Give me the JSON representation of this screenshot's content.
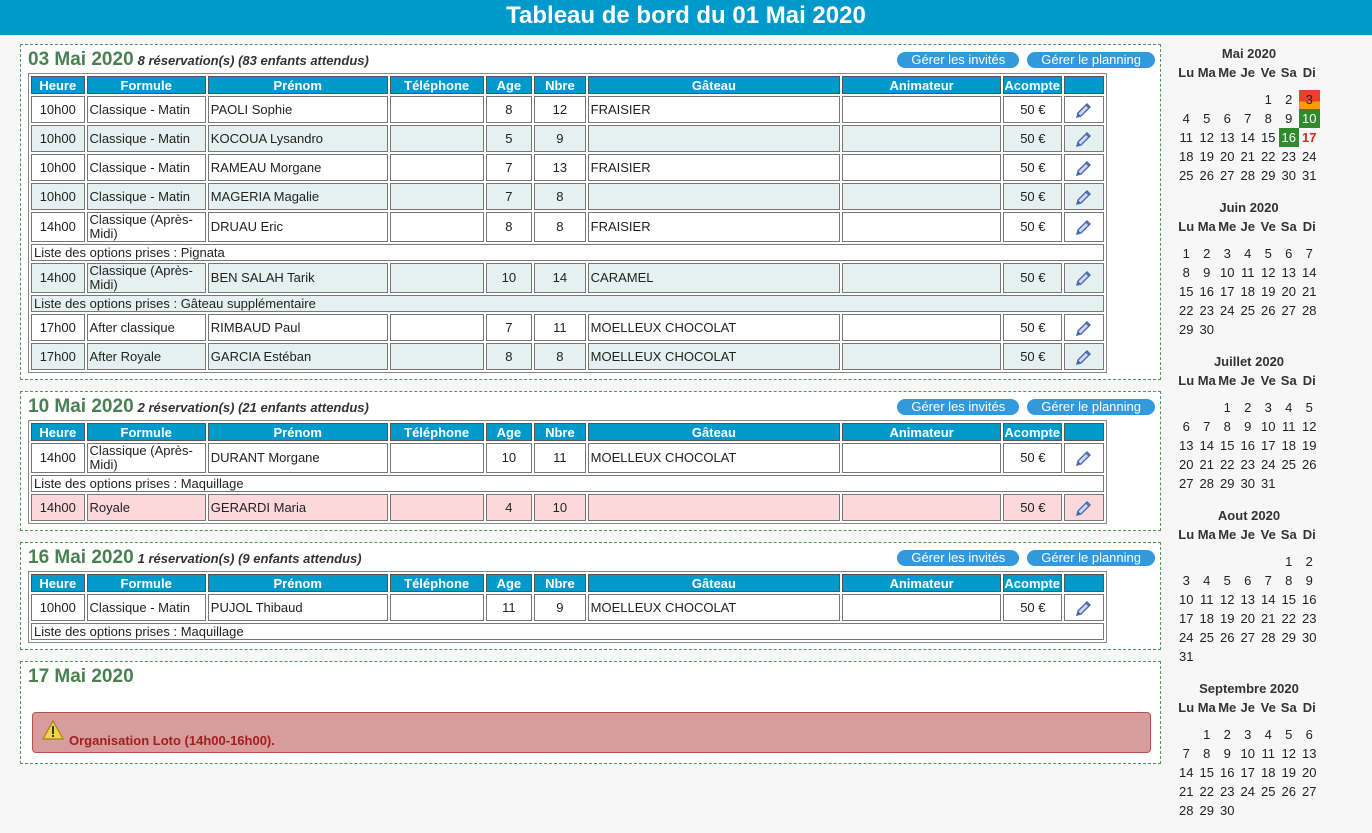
{
  "page_title": "Tableau de bord du 01 Mai 2020",
  "buttons": {
    "guests": "Gérer les invités",
    "planning": "Gérer le planning"
  },
  "columns": [
    "Heure",
    "Formule",
    "Prénom",
    "Téléphone",
    "Age",
    "Nbre",
    "Gâteau",
    "Animateur",
    "Acompte",
    ""
  ],
  "sections": [
    {
      "date": "03 Mai 2020",
      "summary": "8 réservation(s) (83 enfants attendus)",
      "rows": [
        {
          "type": "res",
          "style": "odd",
          "heure": "10h00",
          "formule": "Classique - Matin",
          "prenom": "PAOLI Sophie",
          "telephone": "",
          "age": "8",
          "nbre": "12",
          "gateau": "FRAISIER",
          "animateur": "",
          "acompte": "50 €"
        },
        {
          "type": "res",
          "style": "even",
          "heure": "10h00",
          "formule": "Classique - Matin",
          "prenom": "KOCOUA Lysandro",
          "telephone": "",
          "age": "5",
          "nbre": "9",
          "gateau": "",
          "animateur": "",
          "acompte": "50 €"
        },
        {
          "type": "res",
          "style": "odd",
          "heure": "10h00",
          "formule": "Classique - Matin",
          "prenom": "RAMEAU Morgane",
          "telephone": "",
          "age": "7",
          "nbre": "13",
          "gateau": "FRAISIER",
          "animateur": "",
          "acompte": "50 €"
        },
        {
          "type": "res",
          "style": "even",
          "heure": "10h00",
          "formule": "Classique - Matin",
          "prenom": "MAGERIA Magalie",
          "telephone": "",
          "age": "7",
          "nbre": "8",
          "gateau": "",
          "animateur": "",
          "acompte": "50 €"
        },
        {
          "type": "res",
          "style": "odd",
          "heure": "14h00",
          "formule": "Classique (Après-Midi)",
          "prenom": "DRUAU Eric",
          "telephone": "",
          "age": "8",
          "nbre": "8",
          "gateau": "FRAISIER",
          "animateur": "",
          "acompte": "50 €"
        },
        {
          "type": "opt",
          "style": "odd",
          "text": "Liste des options prises : Pignata"
        },
        {
          "type": "res",
          "style": "even",
          "heure": "14h00",
          "formule": "Classique (Après-Midi)",
          "prenom": "BEN SALAH Tarik",
          "telephone": "",
          "age": "10",
          "nbre": "14",
          "gateau": "CARAMEL",
          "animateur": "",
          "acompte": "50 €"
        },
        {
          "type": "opt",
          "style": "even",
          "text": "Liste des options prises : Gâteau supplémentaire"
        },
        {
          "type": "res",
          "style": "odd",
          "heure": "17h00",
          "formule": "After classique",
          "prenom": "RIMBAUD Paul",
          "telephone": "",
          "age": "7",
          "nbre": "11",
          "gateau": "MOELLEUX CHOCOLAT",
          "animateur": "",
          "acompte": "50 €"
        },
        {
          "type": "res",
          "style": "even",
          "heure": "17h00",
          "formule": "After Royale",
          "prenom": "GARCIA Estéban",
          "telephone": "",
          "age": "8",
          "nbre": "8",
          "gateau": "MOELLEUX CHOCOLAT",
          "animateur": "",
          "acompte": "50 €"
        }
      ]
    },
    {
      "date": "10 Mai 2020",
      "summary": "2 réservation(s) (21 enfants attendus)",
      "rows": [
        {
          "type": "res",
          "style": "odd",
          "heure": "14h00",
          "formule": "Classique (Après-Midi)",
          "prenom": "DURANT Morgane",
          "telephone": "",
          "age": "10",
          "nbre": "11",
          "gateau": "MOELLEUX CHOCOLAT",
          "animateur": "",
          "acompte": "50 €"
        },
        {
          "type": "opt",
          "style": "odd",
          "text": "Liste des options prises : Maquillage"
        },
        {
          "type": "res",
          "style": "pink",
          "heure": "14h00",
          "formule": "Royale",
          "prenom": "GERARDI Maria",
          "telephone": "",
          "age": "4",
          "nbre": "10",
          "gateau": "",
          "animateur": "",
          "acompte": "50 €"
        }
      ]
    },
    {
      "date": "16 Mai 2020",
      "summary": "1 réservation(s) (9 enfants attendus)",
      "rows": [
        {
          "type": "res",
          "style": "odd",
          "heure": "10h00",
          "formule": "Classique - Matin",
          "prenom": "PUJOL Thibaud",
          "telephone": "",
          "age": "11",
          "nbre": "9",
          "gateau": "MOELLEUX CHOCOLAT",
          "animateur": "",
          "acompte": "50 €"
        },
        {
          "type": "opt",
          "style": "odd",
          "text": "Liste des options prises : Maquillage"
        }
      ]
    }
  ],
  "event": {
    "date": "17 Mai 2020",
    "message": "Organisation Loto (14h00-16h00).",
    "icon": "warning-icon"
  },
  "calendar": {
    "weekdays": [
      "Lu",
      "Ma",
      "Me",
      "Je",
      "Ve",
      "Sa",
      "Di"
    ],
    "months": [
      {
        "title": "Mai 2020",
        "first_weekday": 4,
        "days": 31,
        "highlights": {
          "3": "orange",
          "10": "green",
          "16": "green",
          "17": "red"
        }
      },
      {
        "title": "Juin 2020",
        "first_weekday": 0,
        "days": 30,
        "highlights": {}
      },
      {
        "title": "Juillet 2020",
        "first_weekday": 2,
        "days": 31,
        "highlights": {}
      },
      {
        "title": "Aout 2020",
        "first_weekday": 5,
        "days": 31,
        "highlights": {}
      },
      {
        "title": "Septembre 2020",
        "first_weekday": 1,
        "days": 30,
        "highlights": {}
      }
    ],
    "colors": {
      "orange": "#e9402a",
      "green": "#2e8b2e",
      "red": "#e02020"
    }
  }
}
